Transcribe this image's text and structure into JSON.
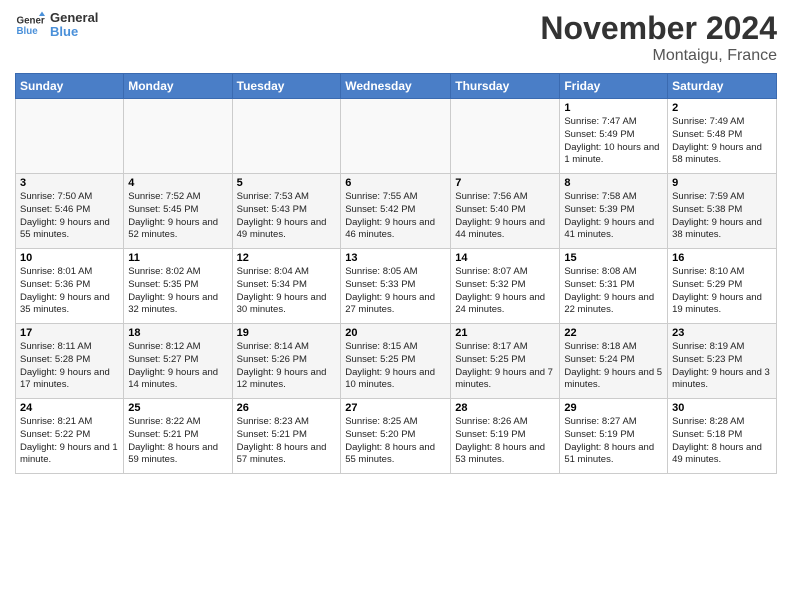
{
  "header": {
    "logo_line1": "General",
    "logo_line2": "Blue",
    "month": "November 2024",
    "location": "Montaigu, France"
  },
  "weekdays": [
    "Sunday",
    "Monday",
    "Tuesday",
    "Wednesday",
    "Thursday",
    "Friday",
    "Saturday"
  ],
  "weeks": [
    [
      {
        "day": "",
        "info": ""
      },
      {
        "day": "",
        "info": ""
      },
      {
        "day": "",
        "info": ""
      },
      {
        "day": "",
        "info": ""
      },
      {
        "day": "",
        "info": ""
      },
      {
        "day": "1",
        "info": "Sunrise: 7:47 AM\nSunset: 5:49 PM\nDaylight: 10 hours and 1 minute."
      },
      {
        "day": "2",
        "info": "Sunrise: 7:49 AM\nSunset: 5:48 PM\nDaylight: 9 hours and 58 minutes."
      }
    ],
    [
      {
        "day": "3",
        "info": "Sunrise: 7:50 AM\nSunset: 5:46 PM\nDaylight: 9 hours and 55 minutes."
      },
      {
        "day": "4",
        "info": "Sunrise: 7:52 AM\nSunset: 5:45 PM\nDaylight: 9 hours and 52 minutes."
      },
      {
        "day": "5",
        "info": "Sunrise: 7:53 AM\nSunset: 5:43 PM\nDaylight: 9 hours and 49 minutes."
      },
      {
        "day": "6",
        "info": "Sunrise: 7:55 AM\nSunset: 5:42 PM\nDaylight: 9 hours and 46 minutes."
      },
      {
        "day": "7",
        "info": "Sunrise: 7:56 AM\nSunset: 5:40 PM\nDaylight: 9 hours and 44 minutes."
      },
      {
        "day": "8",
        "info": "Sunrise: 7:58 AM\nSunset: 5:39 PM\nDaylight: 9 hours and 41 minutes."
      },
      {
        "day": "9",
        "info": "Sunrise: 7:59 AM\nSunset: 5:38 PM\nDaylight: 9 hours and 38 minutes."
      }
    ],
    [
      {
        "day": "10",
        "info": "Sunrise: 8:01 AM\nSunset: 5:36 PM\nDaylight: 9 hours and 35 minutes."
      },
      {
        "day": "11",
        "info": "Sunrise: 8:02 AM\nSunset: 5:35 PM\nDaylight: 9 hours and 32 minutes."
      },
      {
        "day": "12",
        "info": "Sunrise: 8:04 AM\nSunset: 5:34 PM\nDaylight: 9 hours and 30 minutes."
      },
      {
        "day": "13",
        "info": "Sunrise: 8:05 AM\nSunset: 5:33 PM\nDaylight: 9 hours and 27 minutes."
      },
      {
        "day": "14",
        "info": "Sunrise: 8:07 AM\nSunset: 5:32 PM\nDaylight: 9 hours and 24 minutes."
      },
      {
        "day": "15",
        "info": "Sunrise: 8:08 AM\nSunset: 5:31 PM\nDaylight: 9 hours and 22 minutes."
      },
      {
        "day": "16",
        "info": "Sunrise: 8:10 AM\nSunset: 5:29 PM\nDaylight: 9 hours and 19 minutes."
      }
    ],
    [
      {
        "day": "17",
        "info": "Sunrise: 8:11 AM\nSunset: 5:28 PM\nDaylight: 9 hours and 17 minutes."
      },
      {
        "day": "18",
        "info": "Sunrise: 8:12 AM\nSunset: 5:27 PM\nDaylight: 9 hours and 14 minutes."
      },
      {
        "day": "19",
        "info": "Sunrise: 8:14 AM\nSunset: 5:26 PM\nDaylight: 9 hours and 12 minutes."
      },
      {
        "day": "20",
        "info": "Sunrise: 8:15 AM\nSunset: 5:25 PM\nDaylight: 9 hours and 10 minutes."
      },
      {
        "day": "21",
        "info": "Sunrise: 8:17 AM\nSunset: 5:25 PM\nDaylight: 9 hours and 7 minutes."
      },
      {
        "day": "22",
        "info": "Sunrise: 8:18 AM\nSunset: 5:24 PM\nDaylight: 9 hours and 5 minutes."
      },
      {
        "day": "23",
        "info": "Sunrise: 8:19 AM\nSunset: 5:23 PM\nDaylight: 9 hours and 3 minutes."
      }
    ],
    [
      {
        "day": "24",
        "info": "Sunrise: 8:21 AM\nSunset: 5:22 PM\nDaylight: 9 hours and 1 minute."
      },
      {
        "day": "25",
        "info": "Sunrise: 8:22 AM\nSunset: 5:21 PM\nDaylight: 8 hours and 59 minutes."
      },
      {
        "day": "26",
        "info": "Sunrise: 8:23 AM\nSunset: 5:21 PM\nDaylight: 8 hours and 57 minutes."
      },
      {
        "day": "27",
        "info": "Sunrise: 8:25 AM\nSunset: 5:20 PM\nDaylight: 8 hours and 55 minutes."
      },
      {
        "day": "28",
        "info": "Sunrise: 8:26 AM\nSunset: 5:19 PM\nDaylight: 8 hours and 53 minutes."
      },
      {
        "day": "29",
        "info": "Sunrise: 8:27 AM\nSunset: 5:19 PM\nDaylight: 8 hours and 51 minutes."
      },
      {
        "day": "30",
        "info": "Sunrise: 8:28 AM\nSunset: 5:18 PM\nDaylight: 8 hours and 49 minutes."
      }
    ]
  ]
}
